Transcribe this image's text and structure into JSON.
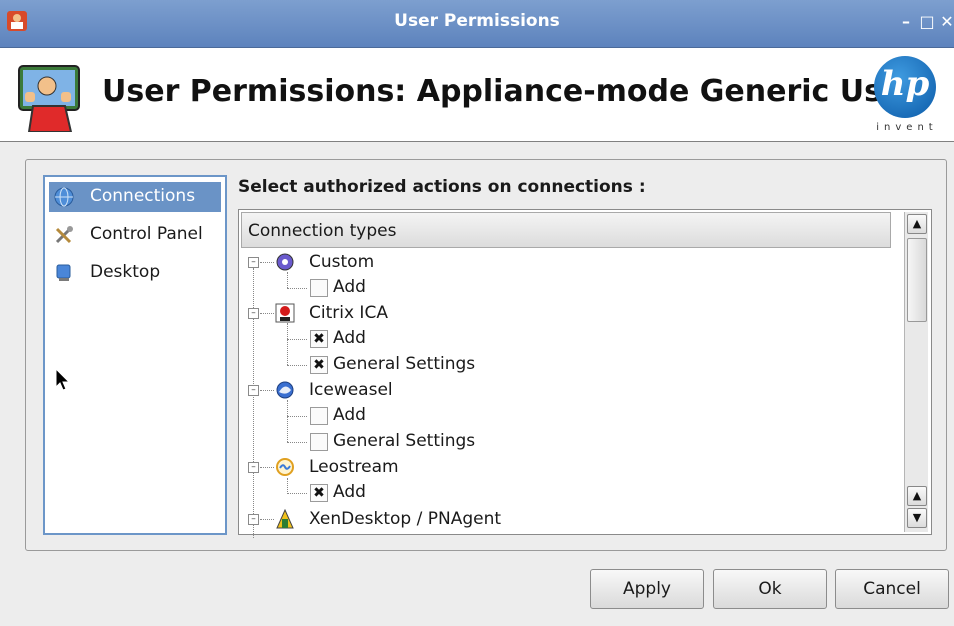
{
  "window": {
    "title": "User Permissions",
    "controls": [
      "minimize",
      "maximize",
      "close"
    ]
  },
  "header": {
    "heading": "User Permissions: Appliance-mode Generic User",
    "logo": {
      "mark": "hp",
      "tagline": "invent"
    }
  },
  "sidebar": {
    "items": [
      {
        "label": "Connections",
        "icon": "globe-icon",
        "selected": true
      },
      {
        "label": "Control Panel",
        "icon": "tools-icon",
        "selected": false
      },
      {
        "label": "Desktop",
        "icon": "monitor-icon",
        "selected": false
      }
    ]
  },
  "main": {
    "section_label": "Select authorized actions on connections :",
    "tree_header": "Connection types",
    "connections": [
      {
        "name": "Custom",
        "icon": "custom-connection-icon",
        "actions": [
          {
            "label": "Add",
            "checked": false
          }
        ]
      },
      {
        "name": "Citrix ICA",
        "icon": "citrix-icon",
        "actions": [
          {
            "label": "Add",
            "checked": true
          },
          {
            "label": "General Settings",
            "checked": true
          }
        ]
      },
      {
        "name": "Iceweasel",
        "icon": "iceweasel-icon",
        "actions": [
          {
            "label": "Add",
            "checked": false
          },
          {
            "label": "General Settings",
            "checked": false
          }
        ]
      },
      {
        "name": "Leostream",
        "icon": "leostream-icon",
        "actions": [
          {
            "label": "Add",
            "checked": true
          }
        ]
      },
      {
        "name": "XenDesktop / PNAgent",
        "icon": "xendesktop-icon",
        "actions": []
      }
    ]
  },
  "buttons": {
    "apply": "Apply",
    "ok": "Ok",
    "cancel": "Cancel"
  },
  "colors": {
    "titlebar": "#6a8ec6",
    "selection": "#6a93c6",
    "nav_border": "#6c96c8"
  }
}
